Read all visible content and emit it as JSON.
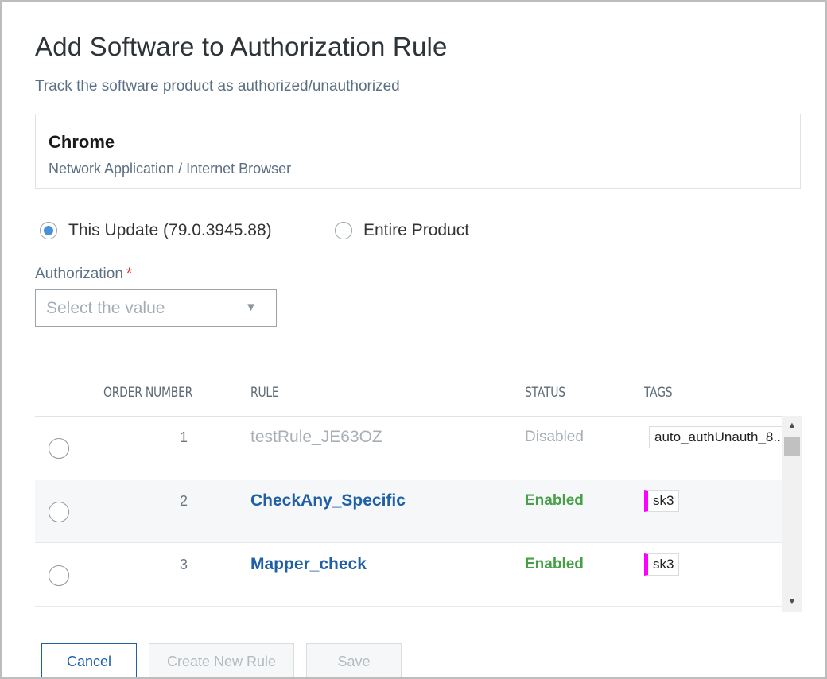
{
  "dialog": {
    "title": "Add Software to Authorization Rule",
    "subtitle": "Track the software product as authorized/unauthorized"
  },
  "product": {
    "name": "Chrome",
    "category": "Network Application / Internet Browser"
  },
  "scope_options": [
    {
      "label": "This Update (79.0.3945.88)",
      "checked": true
    },
    {
      "label": "Entire Product",
      "checked": false
    }
  ],
  "authorization": {
    "label": "Authorization",
    "required_marker": "*",
    "placeholder": "Select the value",
    "caret": "▼"
  },
  "table": {
    "columns": [
      "ORDER NUMBER",
      "RULE",
      "STATUS",
      "TAGS"
    ],
    "rows": [
      {
        "order": "1",
        "rule": "testRule_JE63OZ",
        "status": "Disabled",
        "tag": "auto_authUnauth_8...",
        "tag_color": ""
      },
      {
        "order": "2",
        "rule": "CheckAny_Specific",
        "status": "Enabled",
        "tag": "sk3",
        "tag_color": "#ff00ff"
      },
      {
        "order": "3",
        "rule": "Mapper_check",
        "status": "Enabled",
        "tag": "sk3",
        "tag_color": "#ff00ff"
      }
    ]
  },
  "scrollbar": {
    "up": "▲",
    "down": "▼"
  },
  "buttons": {
    "cancel": "Cancel",
    "create_new_rule": "Create New Rule",
    "save": "Save"
  },
  "colors": {
    "link": "#1f5fa6",
    "enabled": "#47a047",
    "disabled_text": "#a7b0b7",
    "radio_checked": "#4a90d9",
    "required": "#d9342b"
  }
}
